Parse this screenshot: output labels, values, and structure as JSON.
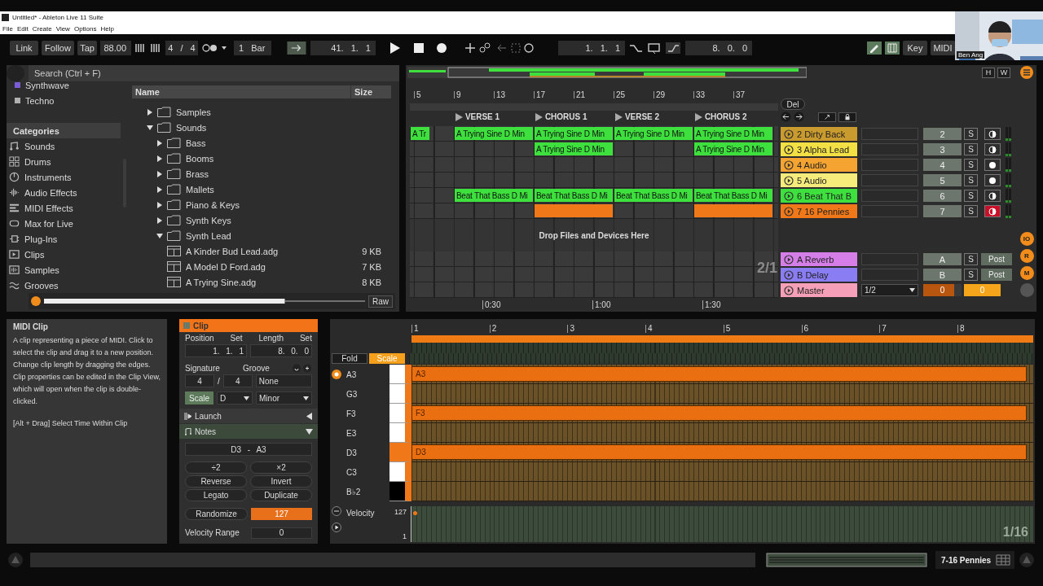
{
  "window": {
    "title": "Untitled* - Ableton Live 11 Suite",
    "menu": [
      "File",
      "Edit",
      "Create",
      "View",
      "Options",
      "Help"
    ]
  },
  "video_tile": {
    "name": "Ben Ang"
  },
  "transport": {
    "link": "Link",
    "follow": "Follow",
    "tap": "Tap",
    "tempo": "88.00",
    "signature": "4 / 4",
    "quantization": "1 Bar",
    "position": "41. 1. 1",
    "loop_start": "1. 1. 1",
    "loop_length": "8. 0. 0",
    "key": "Key",
    "midi": "MIDI"
  },
  "browser": {
    "search": {
      "placeholder": "Search (Ctrl + F)"
    },
    "collections": [
      {
        "label": "Synthwave",
        "color": "#7a5cd6"
      },
      {
        "label": "Techno",
        "color": "#b0b0b0"
      }
    ],
    "categories_heading": "Categories",
    "categories": [
      "Sounds",
      "Drums",
      "Instruments",
      "Audio Effects",
      "MIDI Effects",
      "Max for Live",
      "Plug-Ins",
      "Clips",
      "Samples",
      "Grooves"
    ],
    "columns": [
      "Name",
      "Size"
    ],
    "tree": [
      {
        "kind": "folder",
        "label": "Samples",
        "expanded": false
      },
      {
        "kind": "folder",
        "label": "Sounds",
        "expanded": true,
        "children": [
          {
            "kind": "folder",
            "label": "Bass",
            "expanded": false
          },
          {
            "kind": "folder",
            "label": "Booms",
            "expanded": false
          },
          {
            "kind": "folder",
            "label": "Brass",
            "expanded": false
          },
          {
            "kind": "folder",
            "label": "Mallets",
            "expanded": false
          },
          {
            "kind": "folder",
            "label": "Piano & Keys",
            "expanded": false
          },
          {
            "kind": "folder",
            "label": "Synth Keys",
            "expanded": false
          },
          {
            "kind": "folder",
            "label": "Synth Lead",
            "expanded": true,
            "children": [
              {
                "kind": "preset",
                "label": "A Kinder Bud Lead.adg",
                "size": "9 KB"
              },
              {
                "kind": "preset",
                "label": "A Model D Ford.adg",
                "size": "7 KB"
              },
              {
                "kind": "preset",
                "label": "A Trying Sine.adg",
                "size": "8 KB"
              }
            ]
          }
        ]
      }
    ],
    "preview": {
      "raw": "Raw"
    }
  },
  "arrangement": {
    "overview_buttons": [
      "H",
      "W"
    ],
    "ruler": [
      "5",
      "9",
      "13",
      "17",
      "21",
      "25",
      "29",
      "33",
      "37"
    ],
    "locators": [
      "VERSE 1",
      "CHORUS 1",
      "VERSE 2",
      "CHORUS 2"
    ],
    "del": "Del",
    "tracks": [
      {
        "name": "2 Dirty Back",
        "color": "#c99a2e",
        "number": "2",
        "solo": "S",
        "kind": "midi",
        "armed": false,
        "clips": [
          {
            "kind": "clip",
            "label": "A Tr",
            "color": "#3ee03e"
          },
          {
            "kind": "clip",
            "label": "A Trying Sine D Min",
            "color": "#3ee03e"
          },
          {
            "kind": "clip",
            "label": "A Trying Sine D Min",
            "color": "#3ee03e"
          },
          {
            "kind": "clip",
            "label": "A Trying Sine D Min",
            "color": "#3ee03e"
          },
          {
            "kind": "clip",
            "label": "A Trying Sine D Min",
            "color": "#3ee03e"
          }
        ]
      },
      {
        "name": "3 Alpha Lead",
        "color": "#f2e045",
        "number": "3",
        "solo": "S",
        "kind": "midi",
        "armed": false,
        "clips": [
          {
            "kind": "empty"
          },
          {
            "kind": "empty"
          },
          {
            "kind": "clip",
            "label": "A Trying Sine D Min",
            "color": "#3ee03e"
          },
          {
            "kind": "empty"
          },
          {
            "kind": "clip",
            "label": "A Trying Sine D Min",
            "color": "#3ee03e"
          }
        ]
      },
      {
        "name": "4 Audio",
        "color": "#f5a431",
        "number": "4",
        "solo": "S",
        "kind": "audio",
        "armed": false
      },
      {
        "name": "5 Audio",
        "color": "#f5ec7c",
        "number": "5",
        "solo": "S",
        "kind": "audio",
        "armed": false
      },
      {
        "name": "6 Beat That B",
        "color": "#3ee03e",
        "number": "6",
        "solo": "S",
        "kind": "midi",
        "armed": false,
        "clips": [
          {
            "kind": "empty"
          },
          {
            "kind": "clip",
            "label": "Beat That Bass D Mi",
            "color": "#3ee03e"
          },
          {
            "kind": "clip",
            "label": "Beat That Bass D Mi",
            "color": "#3ee03e"
          },
          {
            "kind": "clip",
            "label": "Beat That Bass D Mi",
            "color": "#3ee03e"
          },
          {
            "kind": "clip",
            "label": "Beat That Bass D Mi",
            "color": "#3ee03e"
          }
        ]
      },
      {
        "name": "7 16 Pennies",
        "color": "#f07818",
        "number": "7",
        "solo": "S",
        "kind": "midi",
        "armed": true,
        "clips": [
          {
            "kind": "empty"
          },
          {
            "kind": "empty"
          },
          {
            "kind": "clip",
            "color": "#f07818"
          },
          {
            "kind": "empty"
          },
          {
            "kind": "clip",
            "color": "#f07818"
          }
        ]
      }
    ],
    "drop_hint": "Drop Files and Devices Here",
    "returns": [
      {
        "name": "A Reverb",
        "color": "#d57ee8",
        "letter": "A",
        "solo": "S",
        "post": "Post"
      },
      {
        "name": "B Delay",
        "color": "#8a7cf2",
        "letter": "B",
        "solo": "S",
        "post": "Post"
      }
    ],
    "master": {
      "name": "Master",
      "color": "#f5a0b8",
      "routing": "1/2",
      "volume": "0",
      "cue": "0"
    },
    "grid": "2/1",
    "time_ruler": [
      "0:30",
      "1:00",
      "1:30"
    ],
    "side_buttons": [
      "IO",
      "R",
      "M"
    ]
  },
  "info": {
    "title": "MIDI Clip",
    "text": "A clip representing a piece of MIDI. Click to select the clip and drag it to a new position. Change clip length by dragging the edges. Clip properties can be edited in the Clip View, which will open when the clip is double-clicked.",
    "shortcut": "[Alt + Drag] Select Time Within Clip"
  },
  "clip_panel": {
    "title": "Clip",
    "position": {
      "label": "Position",
      "set": "Set",
      "value": "1. 1. 1"
    },
    "length": {
      "label": "Length",
      "set": "Set",
      "value": "8. 0. 0"
    },
    "signature": {
      "label": "Signature",
      "numerator": "4",
      "separator": "/",
      "denominator": "4"
    },
    "groove": {
      "label": "Groove",
      "value": "None"
    },
    "scale": {
      "label": "Scale",
      "on": true,
      "root": "D",
      "mode": "Minor"
    },
    "sections": [
      {
        "label": "Launch",
        "expanded": false
      },
      {
        "label": "Notes",
        "expanded": true
      }
    ],
    "note_range": "D3 - A3",
    "note_buttons": [
      "÷2",
      "×2",
      "Reverse",
      "Invert",
      "Legato",
      "Duplicate"
    ],
    "randomize": "Randomize",
    "randomize_amount": "127",
    "velocity_range": {
      "label": "Velocity Range",
      "value": "0"
    }
  },
  "piano_roll": {
    "ruler": [
      "1",
      "2",
      "3",
      "4",
      "5",
      "6",
      "7",
      "8"
    ],
    "buttons": [
      {
        "label": "Fold",
        "on": false
      },
      {
        "label": "Scale",
        "on": true
      }
    ],
    "keys": [
      {
        "name": "A3",
        "black": false,
        "root": false,
        "note": "A3"
      },
      {
        "name": "G3",
        "black": false,
        "root": false
      },
      {
        "name": "F3",
        "black": false,
        "root": false,
        "note": "F3"
      },
      {
        "name": "E3",
        "black": false,
        "root": false
      },
      {
        "name": "D3",
        "black": false,
        "root": true,
        "note": "D3"
      },
      {
        "name": "C3",
        "black": false,
        "root": false
      },
      {
        "name": "B♭2",
        "black": true,
        "root": false
      }
    ],
    "velocity": {
      "label": "Velocity",
      "max": "127",
      "min": "1"
    },
    "grid": "1/16"
  },
  "status": {
    "track": "7-16 Pennies"
  }
}
